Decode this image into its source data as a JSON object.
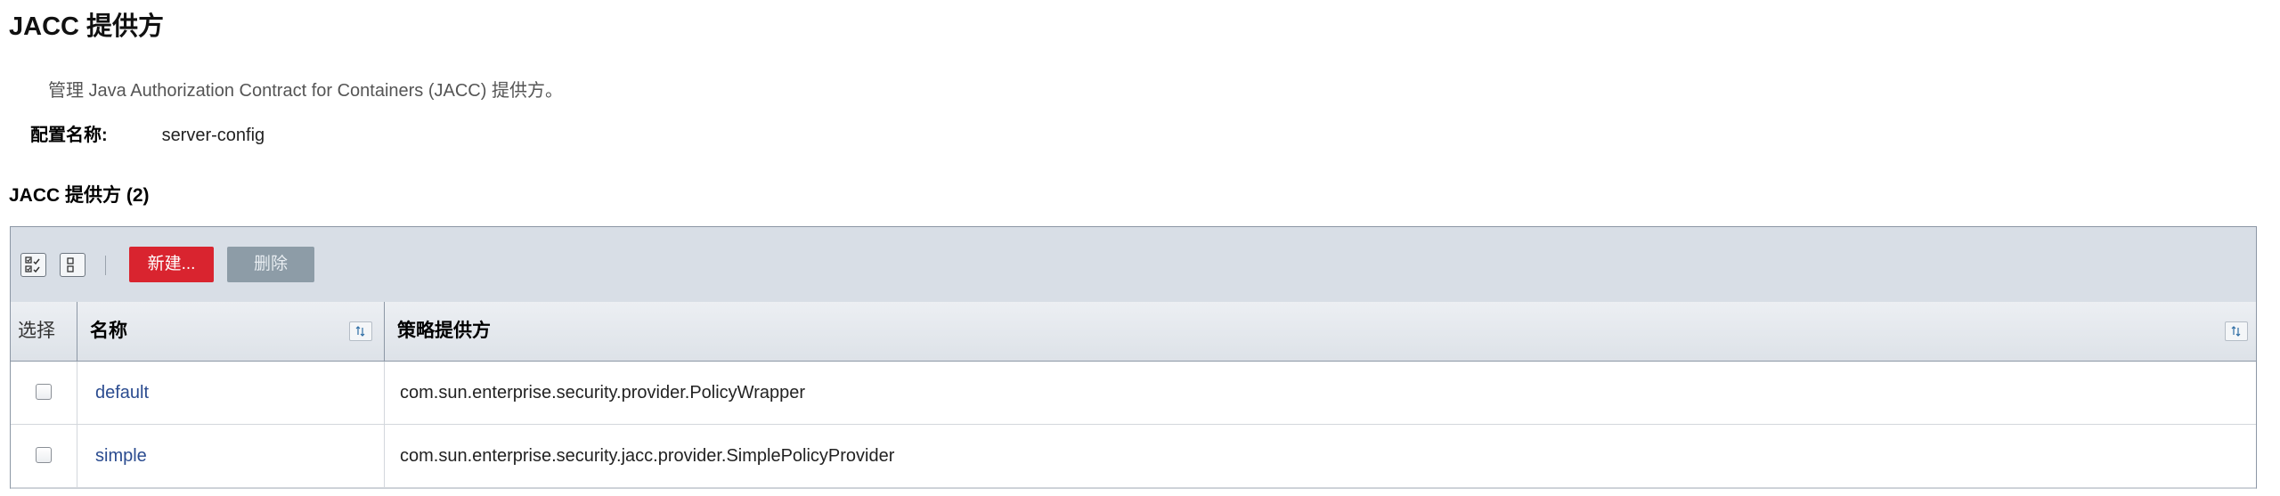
{
  "page": {
    "title": "JACC 提供方",
    "help": "管理 Java Authorization Contract for Containers (JACC) 提供方。",
    "config_label": "配置名称:",
    "config_value": "server-config"
  },
  "table": {
    "title": "JACC 提供方 (2)",
    "toolbar": {
      "select_all_icon": "select-all-icon",
      "deselect_all_icon": "deselect-all-icon",
      "new_label": "新建...",
      "delete_label": "删除"
    },
    "columns": {
      "select": "选择",
      "name": "名称",
      "policy": "策略提供方"
    },
    "rows": [
      {
        "name": "default",
        "policy": "com.sun.enterprise.security.provider.PolicyWrapper",
        "checked": false
      },
      {
        "name": "simple",
        "policy": "com.sun.enterprise.security.jacc.provider.SimplePolicyProvider",
        "checked": false
      }
    ]
  },
  "colors": {
    "primary_button": "#d9242f",
    "disabled_button": "#8d9ca7",
    "toolbar_bg": "#d8dee6",
    "link": "#2b4c90"
  }
}
